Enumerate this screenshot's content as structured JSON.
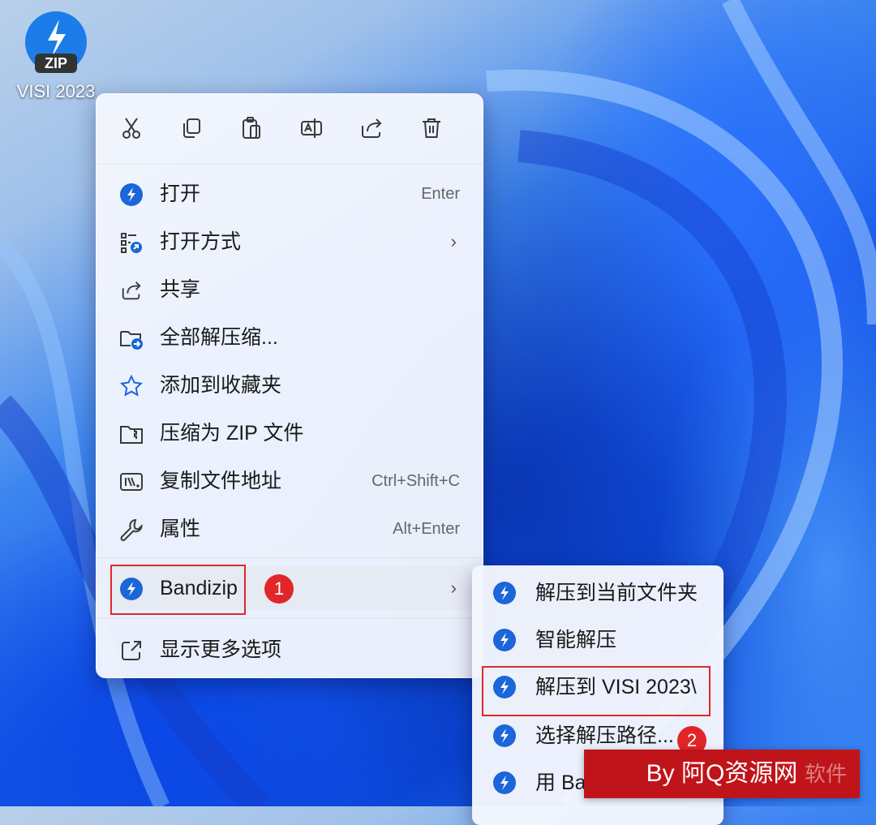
{
  "desktop": {
    "file_icon": {
      "badge": "ZIP",
      "label": "VISI 2023"
    }
  },
  "context_menu": {
    "toolbar": [
      {
        "icon": "cut-icon"
      },
      {
        "icon": "copy-icon"
      },
      {
        "icon": "paste-icon"
      },
      {
        "icon": "rename-icon"
      },
      {
        "icon": "share-icon"
      },
      {
        "icon": "delete-icon"
      }
    ],
    "items": [
      {
        "label": "打开",
        "shortcut": "Enter",
        "icon": "bandizip-icon"
      },
      {
        "label": "打开方式",
        "submenu": true,
        "icon": "open-with-icon"
      },
      {
        "label": "共享",
        "icon": "share-icon"
      },
      {
        "label": "全部解压缩...",
        "icon": "extract-folder-icon"
      },
      {
        "label": "添加到收藏夹",
        "icon": "star-icon"
      },
      {
        "label": "压缩为 ZIP 文件",
        "icon": "zip-folder-icon"
      },
      {
        "label": "复制文件地址",
        "shortcut": "Ctrl+Shift+C",
        "icon": "copy-path-icon"
      },
      {
        "label": "属性",
        "shortcut": "Alt+Enter",
        "icon": "wrench-icon"
      }
    ],
    "bandizip": {
      "label": "Bandizip",
      "submenu": true,
      "step": "1"
    },
    "more": {
      "label": "显示更多选项"
    }
  },
  "bandizip_submenu": {
    "items": [
      {
        "label": "解压到当前文件夹"
      },
      {
        "label": "智能解压"
      },
      {
        "label": "解压到 VISI 2023\\"
      },
      {
        "label": "选择解压路径..."
      },
      {
        "label": "用 Bandizip 打开"
      }
    ],
    "step": "2"
  },
  "watermark": {
    "text": "By 阿Q资源网",
    "behind": "软件"
  },
  "colors": {
    "accent": "#1b66d8",
    "highlight": "#e0282b",
    "watermark": "#c0141b"
  }
}
